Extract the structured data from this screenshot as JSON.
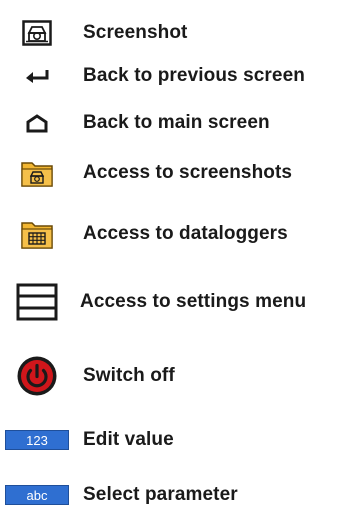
{
  "legend": {
    "items": [
      {
        "icon": "screenshot-icon",
        "label": "Screenshot"
      },
      {
        "icon": "back-arrow-icon",
        "label": "Back to previous screen"
      },
      {
        "icon": "home-icon",
        "label": "Back to main screen"
      },
      {
        "icon": "screenshots-folder-icon",
        "label": "Access to screenshots"
      },
      {
        "icon": "dataloggers-folder-icon",
        "label": "Access to dataloggers"
      },
      {
        "icon": "settings-menu-icon",
        "label": "Access to settings menu"
      },
      {
        "icon": "power-icon",
        "label": "Switch off"
      },
      {
        "icon": "numeric-field-icon",
        "badge": "123",
        "label": "Edit value"
      },
      {
        "icon": "text-field-icon",
        "badge": "abc",
        "label": "Select parameter"
      }
    ]
  },
  "colors": {
    "folder": "#f2b632",
    "power_red": "#d0161b",
    "badge_blue": "#2f6fd1",
    "text": "#1a1a1a"
  }
}
